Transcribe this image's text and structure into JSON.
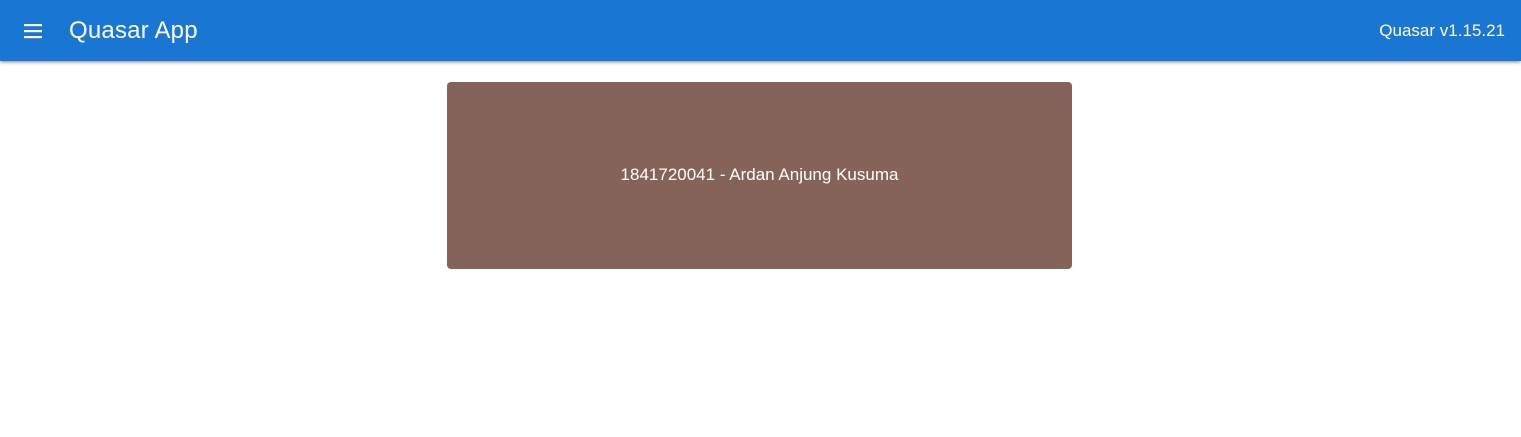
{
  "header": {
    "menu_icon": "menu-icon",
    "title": "Quasar App",
    "version": "Quasar v1.15.21",
    "background": "#1976d2"
  },
  "main": {
    "card": {
      "text": "1841720041 - Ardan Anjung Kusuma",
      "background": "#856358"
    }
  }
}
